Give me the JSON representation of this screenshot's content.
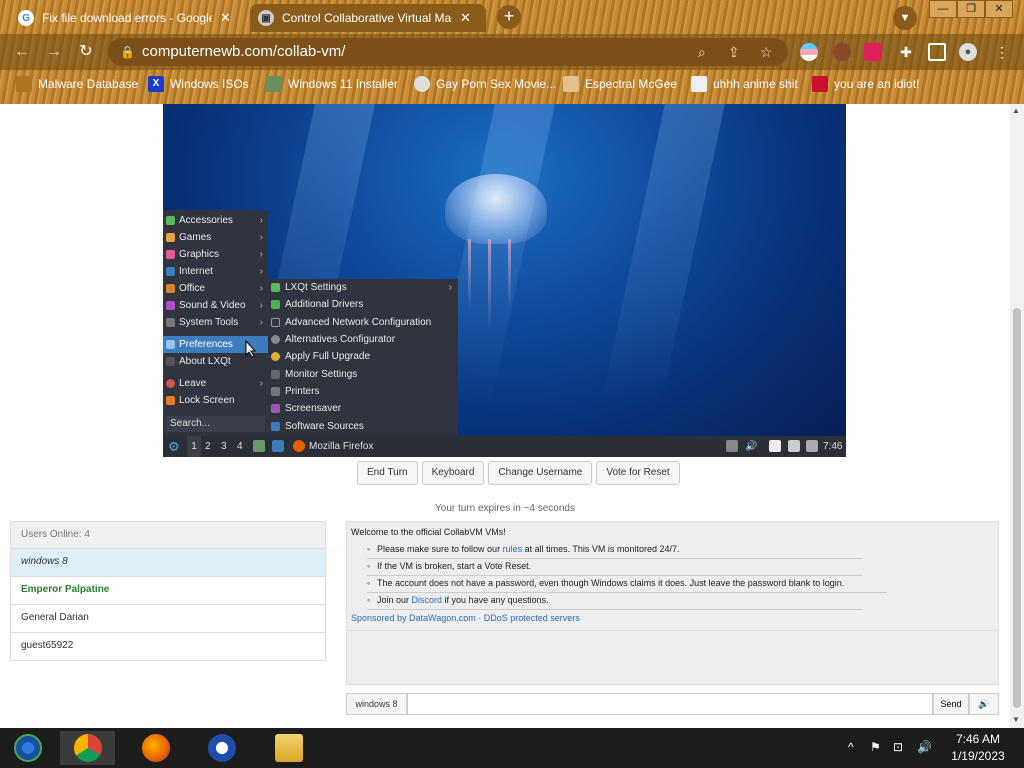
{
  "browser": {
    "tabs": [
      {
        "title": "Fix file download errors - Google",
        "close": "✕",
        "active": false
      },
      {
        "title": "Control Collaborative Virtual Mach",
        "close": "✕",
        "active": true
      }
    ],
    "new_tab": "+",
    "window_controls": [
      "—",
      "❐",
      "✕"
    ],
    "url": "computernewb.com/collab-vm/",
    "bookmarks": [
      "Malware Database",
      "Windows ISOs",
      "Windows 11 Installer",
      "Gay Porn Sex Movie...",
      "Espectral McGee",
      "uhhh anime shit",
      "you are an idiot!"
    ]
  },
  "vm": {
    "menu": {
      "items": [
        {
          "label": "Accessories",
          "sub": true,
          "color": "#5cb85c"
        },
        {
          "label": "Games",
          "sub": true,
          "color": "#e8a33c"
        },
        {
          "label": "Graphics",
          "sub": true,
          "color": "#e05a9a"
        },
        {
          "label": "Internet",
          "sub": true,
          "color": "#3d7dbd"
        },
        {
          "label": "Office",
          "sub": true,
          "color": "#d9822b"
        },
        {
          "label": "Sound & Video",
          "sub": true,
          "color": "#b04dc7"
        },
        {
          "label": "System Tools",
          "sub": true,
          "color": "#777777"
        },
        {
          "label": "Preferences",
          "sub": false,
          "color": "#3d7dbd"
        },
        {
          "label": "About LXQt",
          "sub": false,
          "color": "#555555"
        },
        {
          "label": "Leave",
          "sub": true,
          "color": "#d9534f"
        },
        {
          "label": "Lock Screen",
          "sub": false,
          "color": "#e87a22"
        }
      ],
      "search_placeholder": "Search..."
    },
    "submenu": {
      "items": [
        {
          "label": "LXQt Settings",
          "sub": true,
          "color": "#5cb85c"
        },
        {
          "label": "Additional Drivers",
          "sub": false,
          "color": "#4caf50"
        },
        {
          "label": "Advanced Network Configuration",
          "sub": false,
          "color": "#999999"
        },
        {
          "label": "Alternatives Configurator",
          "sub": false,
          "color": "#888888"
        },
        {
          "label": "Apply Full Upgrade",
          "sub": false,
          "color": "#e0b030"
        },
        {
          "label": "Monitor Settings",
          "sub": false,
          "color": "#666666"
        },
        {
          "label": "Printers",
          "sub": false,
          "color": "#777777"
        },
        {
          "label": "Screensaver",
          "sub": false,
          "color": "#9b59b6"
        },
        {
          "label": "Software Sources",
          "sub": false,
          "color": "#3d7dbd"
        }
      ]
    },
    "taskbar": {
      "desktops": [
        "1",
        "2",
        "3",
        "4"
      ],
      "app": "Mozilla Firefox",
      "time": "7:46"
    }
  },
  "controls": {
    "buttons": [
      "End Turn",
      "Keyboard",
      "Change Username",
      "Vote for Reset"
    ],
    "turn_text": "Your turn expires in ~4 seconds"
  },
  "users": {
    "header": "Users Online: 4",
    "list": [
      "windows 8",
      "Emperor Palpatine",
      "General Darian",
      "guest65922"
    ]
  },
  "chat": {
    "welcome": "Welcome to the official CollabVM VMs!",
    "rules_pre": "Please make sure to follow our ",
    "rules_link": "rules",
    "rules_post": " at all times. This VM is monitored 24/7.",
    "broken": "If the VM is broken, start a Vote Reset.",
    "password": "The account does not have a password, even though Windows claims it does. Just leave the password blank to login.",
    "discord_pre": "Join our ",
    "discord_link": "Discord",
    "discord_post": " if you have any questions.",
    "sponsor": "Sponsored by DataWagon.com · DDoS protected servers",
    "username": "windows 8",
    "send": "Send",
    "sound": "🔊"
  },
  "windows_taskbar": {
    "time": "7:46 AM",
    "date": "1/19/2023"
  }
}
